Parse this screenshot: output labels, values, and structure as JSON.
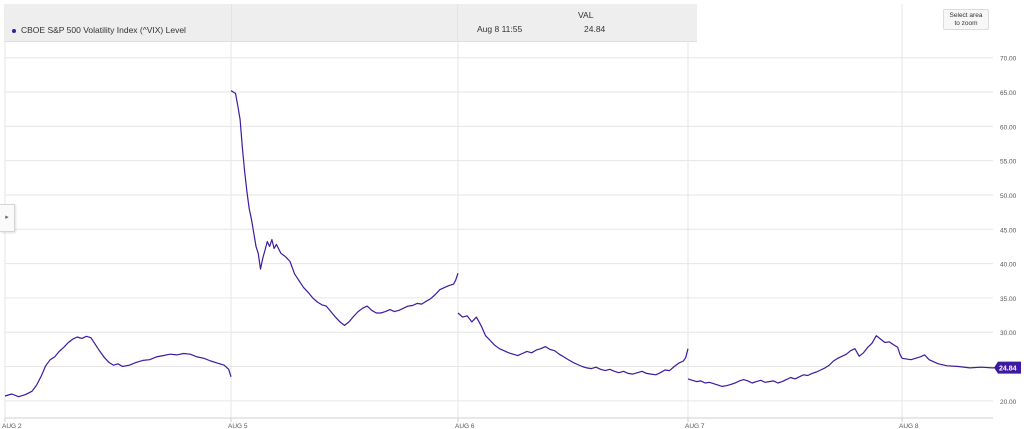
{
  "legend": {
    "series_label": "CBOE S&P 500 Volatility Index (^VIX) Level",
    "value_header": "VAL",
    "hover_date": "Aug 8 11:55",
    "hover_value": "24.84"
  },
  "zoom_button": {
    "line1": "Select area",
    "line2": "to zoom"
  },
  "side_toggle": {
    "icon": "caret-right-icon",
    "glyph": "▸"
  },
  "colors": {
    "line": "#3d1aa0",
    "grid": "#e6e6e6",
    "badge": "#3d1aa0"
  },
  "chart_data": {
    "type": "line",
    "title": "",
    "series_name": "CBOE S&P 500 Volatility Index (^VIX) Level",
    "ylim": [
      17.5,
      72
    ],
    "y_ticks": [
      20,
      25,
      30,
      35,
      40,
      45,
      50,
      55,
      60,
      65,
      70
    ],
    "y_tick_labels": [
      "20.00",
      "25.00",
      "30.00",
      "35.00",
      "40.00",
      "45.00",
      "50.00",
      "55.00",
      "60.00",
      "65.00",
      "70.00"
    ],
    "x_ticks": [
      0,
      1,
      2,
      3,
      4
    ],
    "x_tick_labels": [
      "AUG 2",
      "AUG 5",
      "AUG 6",
      "AUG 7",
      "AUG 8"
    ],
    "last_value": 24.84,
    "last_value_label": "24.84",
    "grid": true,
    "segments": [
      {
        "day": "AUG 2",
        "points": [
          [
            0.0,
            20.7
          ],
          [
            0.03,
            21.0
          ],
          [
            0.06,
            20.6
          ],
          [
            0.09,
            20.9
          ],
          [
            0.12,
            21.4
          ],
          [
            0.14,
            22.3
          ],
          [
            0.16,
            23.6
          ],
          [
            0.18,
            25.1
          ],
          [
            0.2,
            26.0
          ],
          [
            0.22,
            26.4
          ],
          [
            0.24,
            27.2
          ],
          [
            0.26,
            27.8
          ],
          [
            0.28,
            28.5
          ],
          [
            0.3,
            29.0
          ],
          [
            0.32,
            29.3
          ],
          [
            0.34,
            29.1
          ],
          [
            0.36,
            29.4
          ],
          [
            0.38,
            29.2
          ],
          [
            0.4,
            28.2
          ],
          [
            0.42,
            27.2
          ],
          [
            0.44,
            26.3
          ],
          [
            0.46,
            25.6
          ],
          [
            0.48,
            25.2
          ],
          [
            0.5,
            25.4
          ],
          [
            0.52,
            25.0
          ],
          [
            0.55,
            25.2
          ],
          [
            0.58,
            25.6
          ],
          [
            0.61,
            25.9
          ],
          [
            0.64,
            26.0
          ],
          [
            0.67,
            26.4
          ],
          [
            0.7,
            26.6
          ],
          [
            0.73,
            26.8
          ],
          [
            0.76,
            26.7
          ],
          [
            0.79,
            26.9
          ],
          [
            0.82,
            26.8
          ],
          [
            0.85,
            26.4
          ],
          [
            0.88,
            26.2
          ],
          [
            0.91,
            25.8
          ],
          [
            0.94,
            25.5
          ],
          [
            0.97,
            25.2
          ],
          [
            0.99,
            24.6
          ],
          [
            1.0,
            23.5
          ]
        ]
      },
      {
        "day": "AUG 5",
        "points": [
          [
            0.0,
            65.2
          ],
          [
            0.02,
            64.8
          ],
          [
            0.03,
            63.0
          ],
          [
            0.04,
            61.0
          ],
          [
            0.05,
            57.0
          ],
          [
            0.06,
            53.5
          ],
          [
            0.07,
            50.5
          ],
          [
            0.08,
            48.0
          ],
          [
            0.09,
            46.5
          ],
          [
            0.1,
            44.5
          ],
          [
            0.11,
            42.5
          ],
          [
            0.12,
            41.5
          ],
          [
            0.13,
            39.2
          ],
          [
            0.14,
            40.8
          ],
          [
            0.15,
            42.0
          ],
          [
            0.16,
            43.2
          ],
          [
            0.17,
            42.5
          ],
          [
            0.18,
            43.5
          ],
          [
            0.19,
            42.2
          ],
          [
            0.2,
            42.8
          ],
          [
            0.22,
            41.5
          ],
          [
            0.24,
            41.0
          ],
          [
            0.26,
            40.3
          ],
          [
            0.28,
            38.5
          ],
          [
            0.3,
            37.5
          ],
          [
            0.32,
            36.5
          ],
          [
            0.34,
            35.8
          ],
          [
            0.36,
            35.0
          ],
          [
            0.38,
            34.4
          ],
          [
            0.4,
            34.0
          ],
          [
            0.42,
            33.8
          ],
          [
            0.44,
            33.0
          ],
          [
            0.46,
            32.2
          ],
          [
            0.48,
            31.5
          ],
          [
            0.5,
            31.0
          ],
          [
            0.52,
            31.5
          ],
          [
            0.54,
            32.3
          ],
          [
            0.56,
            33.0
          ],
          [
            0.58,
            33.5
          ],
          [
            0.6,
            33.8
          ],
          [
            0.62,
            33.2
          ],
          [
            0.64,
            32.8
          ],
          [
            0.66,
            32.8
          ],
          [
            0.68,
            33.0
          ],
          [
            0.7,
            33.3
          ],
          [
            0.72,
            33.0
          ],
          [
            0.74,
            33.2
          ],
          [
            0.76,
            33.5
          ],
          [
            0.78,
            33.8
          ],
          [
            0.8,
            33.9
          ],
          [
            0.82,
            34.2
          ],
          [
            0.84,
            34.1
          ],
          [
            0.86,
            34.5
          ],
          [
            0.88,
            34.9
          ],
          [
            0.9,
            35.5
          ],
          [
            0.92,
            36.2
          ],
          [
            0.94,
            36.5
          ],
          [
            0.96,
            36.8
          ],
          [
            0.98,
            37.0
          ],
          [
            0.99,
            37.6
          ],
          [
            1.0,
            38.6
          ]
        ]
      },
      {
        "day": "AUG 6",
        "points": [
          [
            0.0,
            32.8
          ],
          [
            0.02,
            32.2
          ],
          [
            0.04,
            32.4
          ],
          [
            0.06,
            31.5
          ],
          [
            0.08,
            32.2
          ],
          [
            0.1,
            31.0
          ],
          [
            0.12,
            29.5
          ],
          [
            0.14,
            28.8
          ],
          [
            0.16,
            28.1
          ],
          [
            0.18,
            27.6
          ],
          [
            0.2,
            27.3
          ],
          [
            0.22,
            27.0
          ],
          [
            0.24,
            26.8
          ],
          [
            0.26,
            26.6
          ],
          [
            0.28,
            26.9
          ],
          [
            0.3,
            27.2
          ],
          [
            0.32,
            27.0
          ],
          [
            0.34,
            27.4
          ],
          [
            0.36,
            27.6
          ],
          [
            0.38,
            27.9
          ],
          [
            0.4,
            27.5
          ],
          [
            0.42,
            27.3
          ],
          [
            0.44,
            26.8
          ],
          [
            0.46,
            26.4
          ],
          [
            0.48,
            26.0
          ],
          [
            0.5,
            25.6
          ],
          [
            0.52,
            25.3
          ],
          [
            0.54,
            25.0
          ],
          [
            0.56,
            24.8
          ],
          [
            0.58,
            24.7
          ],
          [
            0.6,
            24.9
          ],
          [
            0.62,
            24.6
          ],
          [
            0.64,
            24.4
          ],
          [
            0.66,
            24.6
          ],
          [
            0.68,
            24.3
          ],
          [
            0.7,
            24.1
          ],
          [
            0.72,
            24.3
          ],
          [
            0.74,
            24.0
          ],
          [
            0.76,
            23.9
          ],
          [
            0.78,
            24.1
          ],
          [
            0.8,
            24.3
          ],
          [
            0.82,
            24.0
          ],
          [
            0.84,
            23.9
          ],
          [
            0.86,
            23.8
          ],
          [
            0.88,
            24.1
          ],
          [
            0.9,
            24.5
          ],
          [
            0.92,
            24.4
          ],
          [
            0.94,
            25.0
          ],
          [
            0.96,
            25.5
          ],
          [
            0.98,
            25.8
          ],
          [
            0.99,
            26.3
          ],
          [
            1.0,
            27.6
          ]
        ]
      },
      {
        "day": "AUG 7",
        "points": [
          [
            0.0,
            23.2
          ],
          [
            0.02,
            23.0
          ],
          [
            0.04,
            22.8
          ],
          [
            0.06,
            22.9
          ],
          [
            0.08,
            22.6
          ],
          [
            0.1,
            22.7
          ],
          [
            0.12,
            22.5
          ],
          [
            0.14,
            22.3
          ],
          [
            0.16,
            22.1
          ],
          [
            0.18,
            22.2
          ],
          [
            0.2,
            22.4
          ],
          [
            0.22,
            22.6
          ],
          [
            0.24,
            22.9
          ],
          [
            0.26,
            23.1
          ],
          [
            0.28,
            22.9
          ],
          [
            0.3,
            22.6
          ],
          [
            0.32,
            22.8
          ],
          [
            0.34,
            23.0
          ],
          [
            0.36,
            22.7
          ],
          [
            0.38,
            22.8
          ],
          [
            0.4,
            22.9
          ],
          [
            0.42,
            22.6
          ],
          [
            0.44,
            22.8
          ],
          [
            0.46,
            23.1
          ],
          [
            0.48,
            23.4
          ],
          [
            0.5,
            23.2
          ],
          [
            0.52,
            23.5
          ],
          [
            0.54,
            23.8
          ],
          [
            0.56,
            23.7
          ],
          [
            0.58,
            24.0
          ],
          [
            0.6,
            24.2
          ],
          [
            0.62,
            24.5
          ],
          [
            0.64,
            24.8
          ],
          [
            0.66,
            25.2
          ],
          [
            0.68,
            25.8
          ],
          [
            0.7,
            26.2
          ],
          [
            0.72,
            26.5
          ],
          [
            0.74,
            26.8
          ],
          [
            0.76,
            27.3
          ],
          [
            0.78,
            27.6
          ],
          [
            0.8,
            26.5
          ],
          [
            0.82,
            27.0
          ],
          [
            0.84,
            27.8
          ],
          [
            0.86,
            28.4
          ],
          [
            0.88,
            29.5
          ],
          [
            0.9,
            29.0
          ],
          [
            0.92,
            28.5
          ],
          [
            0.94,
            28.6
          ],
          [
            0.96,
            28.2
          ],
          [
            0.98,
            27.8
          ],
          [
            0.99,
            26.8
          ],
          [
            1.0,
            26.2
          ]
        ]
      },
      {
        "day": "AUG 8",
        "points": [
          [
            0.0,
            26.2
          ],
          [
            0.04,
            26.0
          ],
          [
            0.08,
            26.4
          ],
          [
            0.1,
            26.7
          ],
          [
            0.12,
            26.0
          ],
          [
            0.16,
            25.4
          ],
          [
            0.2,
            25.1
          ],
          [
            0.25,
            25.0
          ],
          [
            0.3,
            24.8
          ],
          [
            0.35,
            24.9
          ],
          [
            0.4,
            24.8
          ],
          [
            0.45,
            24.9
          ],
          [
            0.5,
            24.84
          ]
        ]
      }
    ]
  }
}
